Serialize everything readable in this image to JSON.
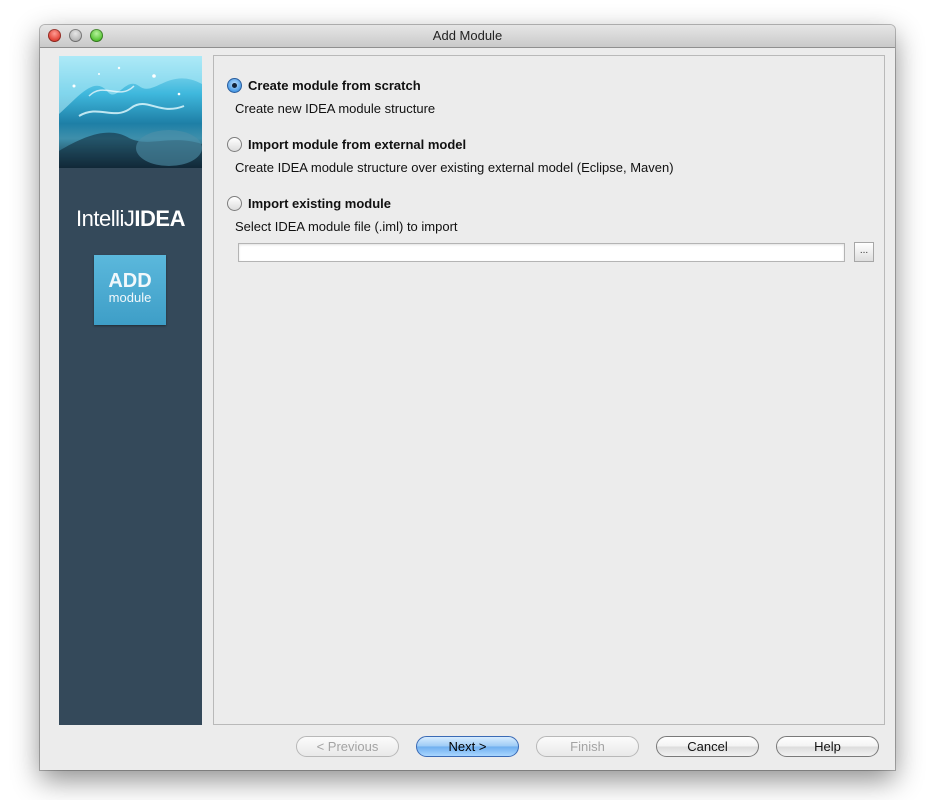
{
  "window": {
    "title": "Add Module"
  },
  "sidebar": {
    "brand_light": "IntelliJ",
    "brand_bold": "IDEA",
    "tile_big": "ADD",
    "tile_small": "module"
  },
  "options": [
    {
      "label": "Create module from scratch",
      "description": "Create new IDEA module structure",
      "selected": true
    },
    {
      "label": "Import module from external model",
      "description": "Create IDEA module structure over existing external model (Eclipse, Maven)",
      "selected": false
    },
    {
      "label": "Import existing module",
      "description": "Select IDEA module file (.iml) to import",
      "selected": false
    }
  ],
  "module_file": {
    "value": "",
    "browse_label": "..."
  },
  "buttons": {
    "previous": "< Previous",
    "next": "Next >",
    "finish": "Finish",
    "cancel": "Cancel",
    "help": "Help"
  },
  "colors": {
    "sidebar": "#34495a",
    "accent": "#3e9ec7",
    "default_button": "#6eaeef"
  }
}
